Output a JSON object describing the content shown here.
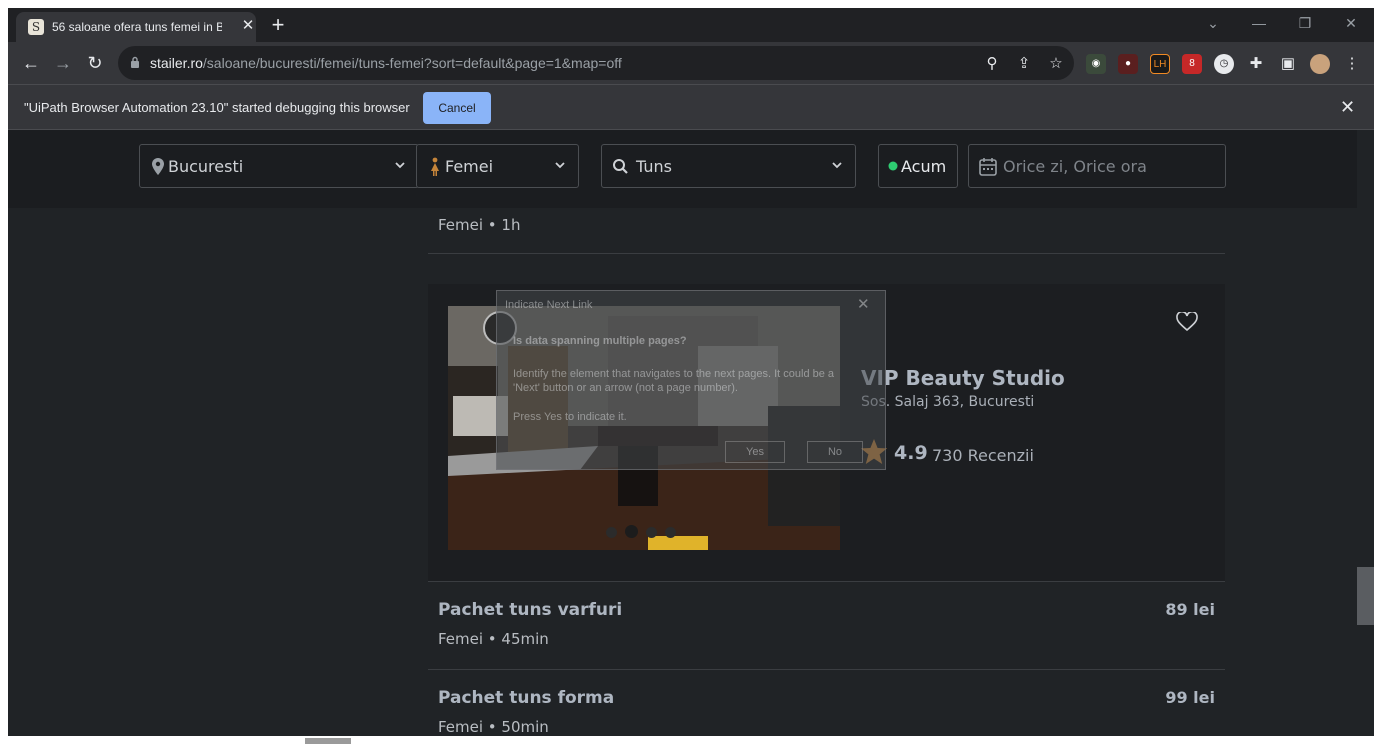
{
  "browser": {
    "tab": {
      "title": "56 saloane ofera tuns femei in B",
      "favicon_letter": "S"
    },
    "url": {
      "host": "stailer.ro",
      "path": "/saloane/bucuresti/femei/tuns-femei?sort=default&page=1&map=off"
    },
    "infobar": {
      "message": "\"UiPath Browser Automation 23.10\" started debugging this browser",
      "cancel_label": "Cancel"
    },
    "extension_badge": "8",
    "lh_label": "LH"
  },
  "filters": {
    "location": "Bucuresti",
    "gender": "Femei",
    "service": "Tuns",
    "now": "Acum",
    "date_placeholder": "Orice zi, Orice ora"
  },
  "previous_service": {
    "meta": "Femei • 1h"
  },
  "salon": {
    "name": "VIP Beauty Studio",
    "address": "Sos. Salaj 363, Bucuresti",
    "rating": "4.9",
    "reviews": "730 Recenzii",
    "photo_count": 4
  },
  "services": [
    {
      "name": "Pachet tuns varfuri",
      "meta": "Femei • 45min",
      "price": "89 lei"
    },
    {
      "name": "Pachet tuns forma",
      "meta": "Femei • 50min",
      "price": "99 lei"
    }
  ],
  "uipath_dialog": {
    "title": "Indicate Next Link",
    "question": "Is data spanning multiple pages?",
    "description": "Identify the element that navigates to the next pages. It could be a 'Next' button or an arrow (not a page number).",
    "press_text": "Press Yes to indicate it.",
    "yes_label": "Yes",
    "no_label": "No"
  },
  "colors": {
    "accent_blue": "#8ab4f8",
    "star": "#c4843a",
    "live_dot": "#2ecc71"
  }
}
